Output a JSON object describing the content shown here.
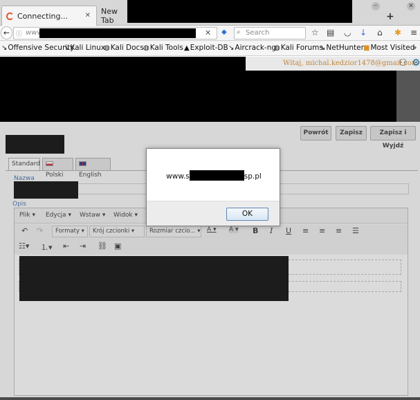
{
  "browser": {
    "tabs": [
      {
        "label": "Connecting...",
        "close": "✕"
      },
      {
        "label": "New Tab"
      }
    ],
    "newtab": "+",
    "window_min": "‒",
    "window_close": "✕",
    "url_text": "www",
    "url_clear": "✕",
    "search_placeholder": "Search",
    "bookmarks": [
      {
        "label": "Offensive Security",
        "icon": "kali-dragon-icon"
      },
      {
        "label": "Kali Linux",
        "icon": "kali-dragon-icon"
      },
      {
        "label": "Kali Docs",
        "icon": "globe-icon"
      },
      {
        "label": "Kali Tools",
        "icon": "globe-icon"
      },
      {
        "label": "Exploit-DB",
        "icon": "exploit-db-icon"
      },
      {
        "label": "Aircrack-ng",
        "icon": "aircrack-icon"
      },
      {
        "label": "Kali Forums",
        "icon": "globe-icon"
      },
      {
        "label": "NetHunter",
        "icon": "kali-dragon-icon"
      },
      {
        "label": "Most Visited",
        "icon": "folder-icon"
      }
    ],
    "bookmarks_more": "»"
  },
  "page": {
    "user_email": "Witaj, michal.kedzior1478@gmail.com",
    "buttons": {
      "back": "Powrót",
      "save": "Zapisz",
      "save_exit": "Zapisz i Wyjdź"
    },
    "lang_tabs": [
      "Standard",
      "Polski",
      "English"
    ],
    "name_label": "Nazwa",
    "desc_label": "Opis",
    "editor": {
      "menus": [
        "Plik ▾",
        "Edycja ▾",
        "Wstaw ▾",
        "Widok ▾"
      ],
      "formats": "Formaty ▾",
      "font_family": "Krój czcionki ▾",
      "font_size": "Rozmiar czcio... ▾",
      "text_color": "A ▾",
      "bg_color": "A ▾",
      "bold": "B",
      "italic": "I",
      "underline": "U"
    }
  },
  "dialog": {
    "message_prefix": "www.s",
    "message_suffix": "sp.pl",
    "ok": "OK"
  }
}
